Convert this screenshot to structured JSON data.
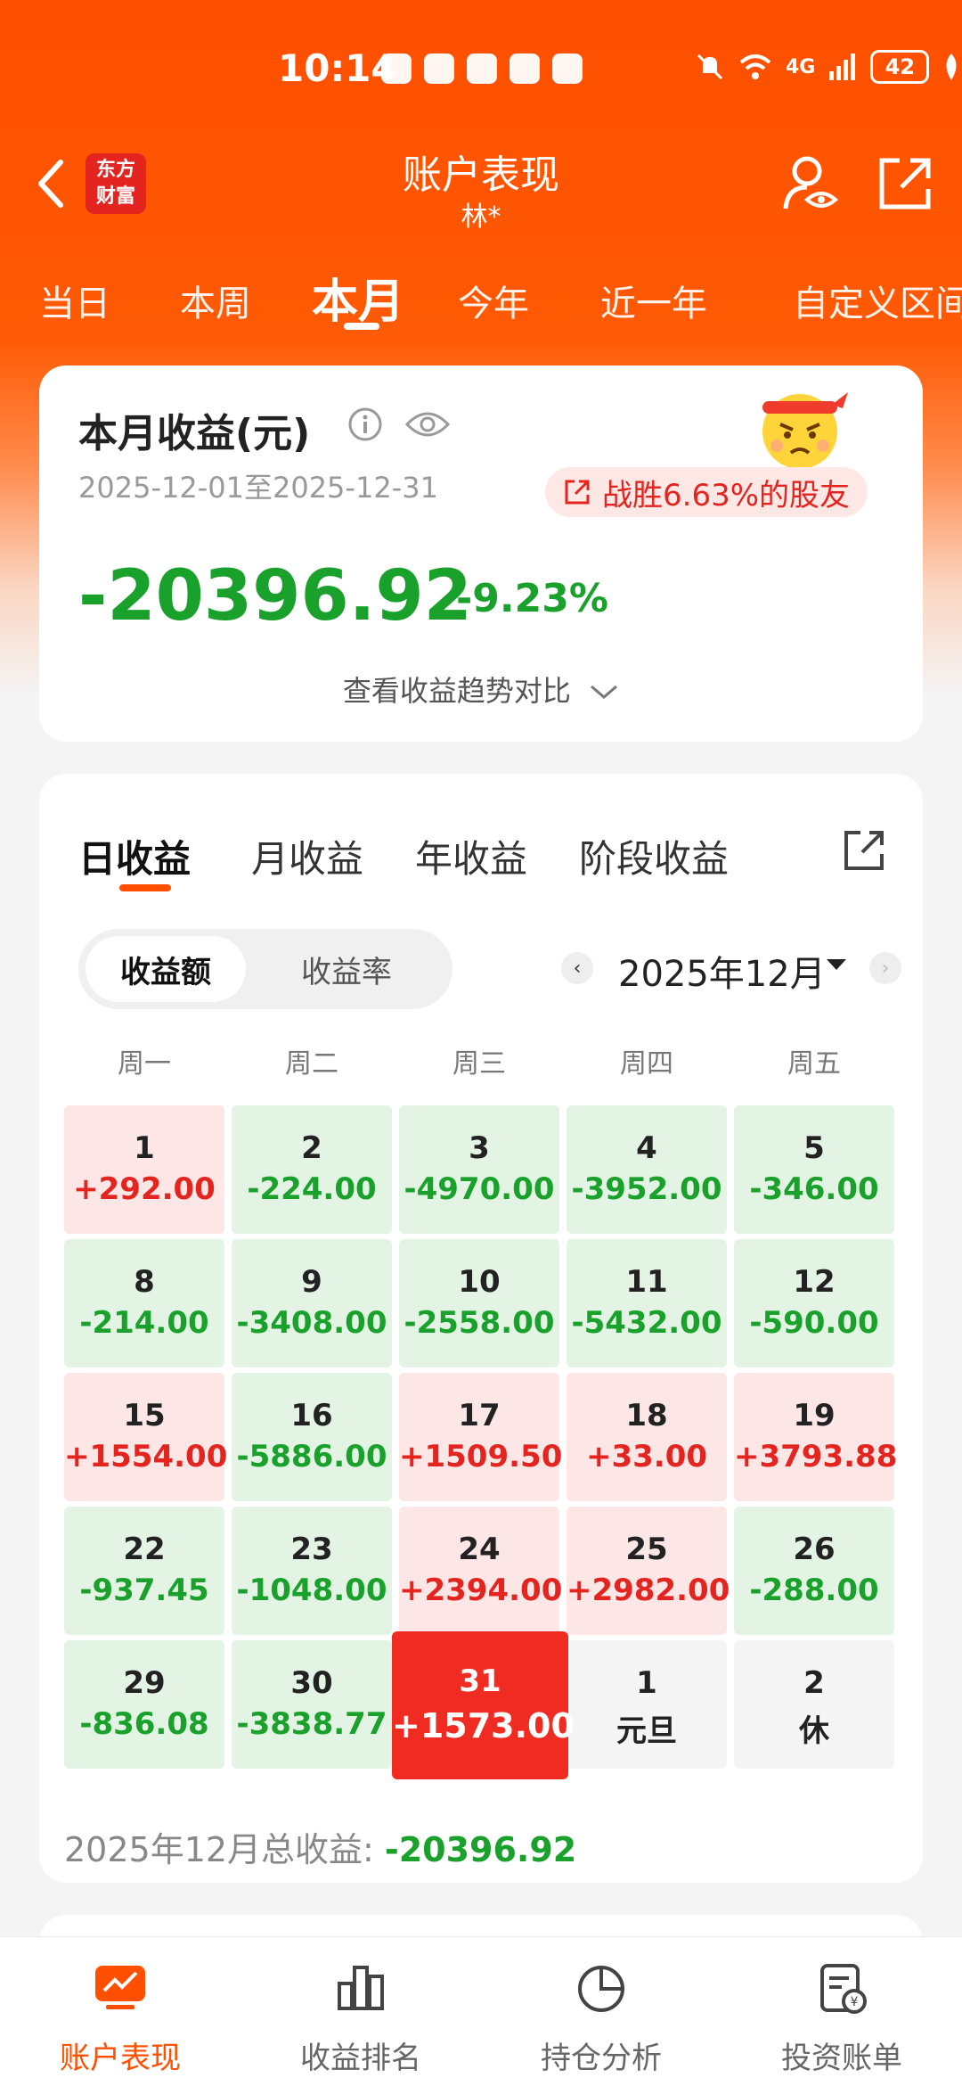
{
  "status_bar": {
    "time": "10:14",
    "network": "4G",
    "battery": "42"
  },
  "header": {
    "logo_text": "东方\n财富",
    "title": "账户表现",
    "subtitle": "林*"
  },
  "period_tabs": [
    {
      "label": "当日",
      "active": false
    },
    {
      "label": "本周",
      "active": false
    },
    {
      "label": "本月",
      "active": true
    },
    {
      "label": "今年",
      "active": false
    },
    {
      "label": "近一年",
      "active": false
    },
    {
      "label": "自定义区间",
      "active": false
    }
  ],
  "summary": {
    "title": "本月收益(元)",
    "date_range": "2025-12-01至2025-12-31",
    "badge": "战胜6.63%的股友",
    "amount": "-20396.92",
    "percent": "-9.23%",
    "trend_link": "查看收益趋势对比"
  },
  "detail": {
    "tabs": [
      {
        "label": "日收益",
        "active": true
      },
      {
        "label": "月收益",
        "active": false
      },
      {
        "label": "年收益",
        "active": false
      },
      {
        "label": "阶段收益",
        "active": false
      }
    ],
    "segment": [
      {
        "label": "收益额",
        "active": true
      },
      {
        "label": "收益率",
        "active": false
      }
    ],
    "month_label": "2025年12月",
    "weekdays": [
      "周一",
      "周二",
      "周三",
      "周四",
      "周五"
    ],
    "days": [
      {
        "day": "1",
        "value": "+292.00",
        "state": "up"
      },
      {
        "day": "2",
        "value": "-224.00",
        "state": "down"
      },
      {
        "day": "3",
        "value": "-4970.00",
        "state": "down"
      },
      {
        "day": "4",
        "value": "-3952.00",
        "state": "down"
      },
      {
        "day": "5",
        "value": "-346.00",
        "state": "down"
      },
      {
        "day": "8",
        "value": "-214.00",
        "state": "down"
      },
      {
        "day": "9",
        "value": "-3408.00",
        "state": "down"
      },
      {
        "day": "10",
        "value": "-2558.00",
        "state": "down"
      },
      {
        "day": "11",
        "value": "-5432.00",
        "state": "down"
      },
      {
        "day": "12",
        "value": "-590.00",
        "state": "down"
      },
      {
        "day": "15",
        "value": "+1554.00",
        "state": "up"
      },
      {
        "day": "16",
        "value": "-5886.00",
        "state": "down"
      },
      {
        "day": "17",
        "value": "+1509.50",
        "state": "up"
      },
      {
        "day": "18",
        "value": "+33.00",
        "state": "up"
      },
      {
        "day": "19",
        "value": "+3793.88",
        "state": "up"
      },
      {
        "day": "22",
        "value": "-937.45",
        "state": "down"
      },
      {
        "day": "23",
        "value": "-1048.00",
        "state": "down"
      },
      {
        "day": "24",
        "value": "+2394.00",
        "state": "up"
      },
      {
        "day": "25",
        "value": "+2982.00",
        "state": "up"
      },
      {
        "day": "26",
        "value": "-288.00",
        "state": "down"
      },
      {
        "day": "29",
        "value": "-836.08",
        "state": "down"
      },
      {
        "day": "30",
        "value": "-3838.77",
        "state": "down"
      },
      {
        "day": "31",
        "value": "+1573.00",
        "state": "today"
      },
      {
        "day": "1",
        "value": "元旦",
        "state": "off"
      },
      {
        "day": "2",
        "value": "休",
        "state": "off"
      }
    ],
    "total_label": "2025年12月总收益: ",
    "total_value": "-20396.92"
  },
  "bottom_nav": [
    {
      "label": "账户表现",
      "icon": "trend-chart-icon",
      "active": true
    },
    {
      "label": "收益排名",
      "icon": "bar-chart-icon",
      "active": false
    },
    {
      "label": "持仓分析",
      "icon": "pie-chart-icon",
      "active": false
    },
    {
      "label": "投资账单",
      "icon": "bill-icon",
      "active": false
    }
  ],
  "colors": {
    "brand": "#ff4f00",
    "gain": "#e3241f",
    "loss": "#19a12c"
  }
}
